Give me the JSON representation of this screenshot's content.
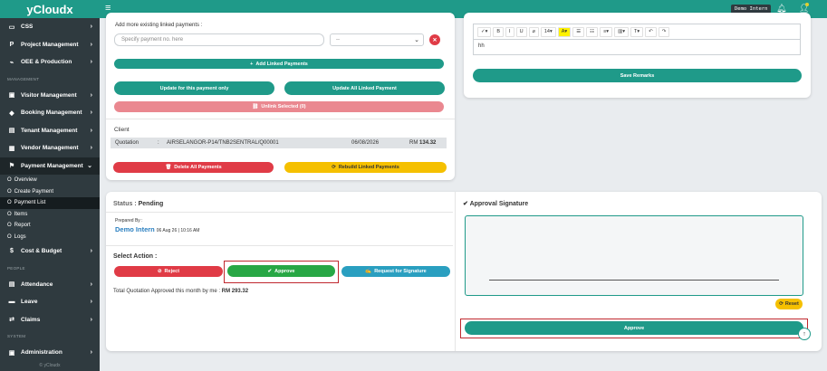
{
  "app": {
    "brand": "yCloudx",
    "user_badge": "Demo Intern",
    "footer": "© yCloudx"
  },
  "sidebar": {
    "top_items": [
      {
        "label": "CSS",
        "icon": "monitor-icon",
        "glyph": "▭"
      },
      {
        "label": "Project Management",
        "icon": "p-icon",
        "glyph": "P"
      },
      {
        "label": "OEE & Production",
        "icon": "chart-icon",
        "glyph": "⌁"
      }
    ],
    "management_header": "MANAGEMENT",
    "management_items": [
      {
        "label": "Visitor Management",
        "glyph": "▣"
      },
      {
        "label": "Booking Management",
        "glyph": "◆"
      },
      {
        "label": "Tenant Management",
        "glyph": "▤"
      },
      {
        "label": "Vendor Management",
        "glyph": "▦"
      },
      {
        "label": "Payment Management",
        "glyph": "⚑"
      }
    ],
    "payment_sub": [
      "Overview",
      "Create Payment",
      "Payment List",
      "Items",
      "Report",
      "Logs"
    ],
    "cost_budget": "Cost & Budget",
    "people_header": "PEOPLE",
    "people_items": [
      {
        "label": "Attendance",
        "glyph": "▤"
      },
      {
        "label": "Leave",
        "glyph": "▬"
      },
      {
        "label": "Claims",
        "glyph": "⇄"
      }
    ],
    "system_header": "SYSTEM",
    "admin": "Administration"
  },
  "linked": {
    "title": "Add more existing linked payments :",
    "input_placeholder": "Specify payment no. here",
    "select_value": "--",
    "add_btn": "Add Linked Payments",
    "update_one": "Update for this payment only",
    "update_all": "Update All Linked Payment",
    "unlink": "Unlink Selected (0)",
    "client_label": "Client",
    "client_type": "Quotation",
    "client_sep": ":",
    "client_ref": "AIRSELANGOR-P14/TNB2SENTRAL/Q00001",
    "client_date": "06/08/2026",
    "client_amount_prefix": "RM",
    "client_amount": "134.32",
    "delete_all": "Delete All Payments",
    "rebuild": "Rebuild Linked Payments"
  },
  "remarks": {
    "toolbar": [
      "✓▾",
      "B",
      "I",
      "U",
      "⌀",
      "14▾",
      "A▾",
      "☰",
      "☷",
      "≡▾",
      "▥▾",
      "T▾",
      "↶",
      "↷"
    ],
    "text": "hh",
    "save_btn": "Save Remarks"
  },
  "status": {
    "label": "Status : ",
    "value": "Pending",
    "prepared_label": "Prepared By :",
    "prepared_name": "Demo Intern",
    "prepared_date": "06 Aug 26 | 10:16 AM",
    "select_action": "Select Action :",
    "reject": "Reject",
    "approve": "Approve",
    "request_sig": "Request for Signature",
    "total_prefix": "Total Quotation Approved this month by me : ",
    "total_value": "RM 293.32"
  },
  "signature": {
    "title": "Approval Signature",
    "reset": "Reset",
    "approve_btn": "Approve"
  }
}
